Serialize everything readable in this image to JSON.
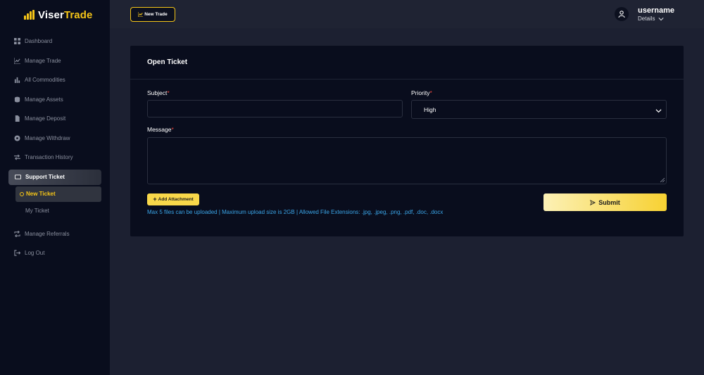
{
  "brand": {
    "name_part1": "Viser",
    "name_part2": "Trade",
    "accent_color": "#f5c518"
  },
  "sidebar": {
    "items": [
      {
        "label": "Dashboard",
        "icon": "dashboard-icon"
      },
      {
        "label": "Manage Trade",
        "icon": "chart-line-icon"
      },
      {
        "label": "All Commodities",
        "icon": "bar-chart-icon"
      },
      {
        "label": "Manage Assets",
        "icon": "coins-icon"
      },
      {
        "label": "Manage Deposit",
        "icon": "file-icon"
      },
      {
        "label": "Manage Withdraw",
        "icon": "money-icon"
      },
      {
        "label": "Transaction History",
        "icon": "exchange-icon"
      },
      {
        "label": "Support Ticket",
        "icon": "ticket-icon",
        "active": true
      },
      {
        "label": "Manage Referrals",
        "icon": "referral-icon"
      },
      {
        "label": "Log Out",
        "icon": "logout-icon"
      }
    ],
    "support_sub": [
      {
        "label": "New Ticket",
        "active": true
      },
      {
        "label": "My Ticket"
      }
    ]
  },
  "topbar": {
    "new_trade_label": "New Trade",
    "username": "username",
    "details_label": "Details"
  },
  "form": {
    "title": "Open Ticket",
    "subject_label": "Subject",
    "subject_value": "",
    "priority_label": "Priority",
    "priority_value": "High",
    "message_label": "Message",
    "message_value": "",
    "required_mark": "*",
    "add_attachment_label": "Add Attachment",
    "attachment_hint": "Max 5 files can be uploaded | Maximum upload size is 2GB | Allowed File Extensions: .jpg, .jpeg, .png, .pdf, .doc, .docx",
    "submit_label": "Submit"
  }
}
